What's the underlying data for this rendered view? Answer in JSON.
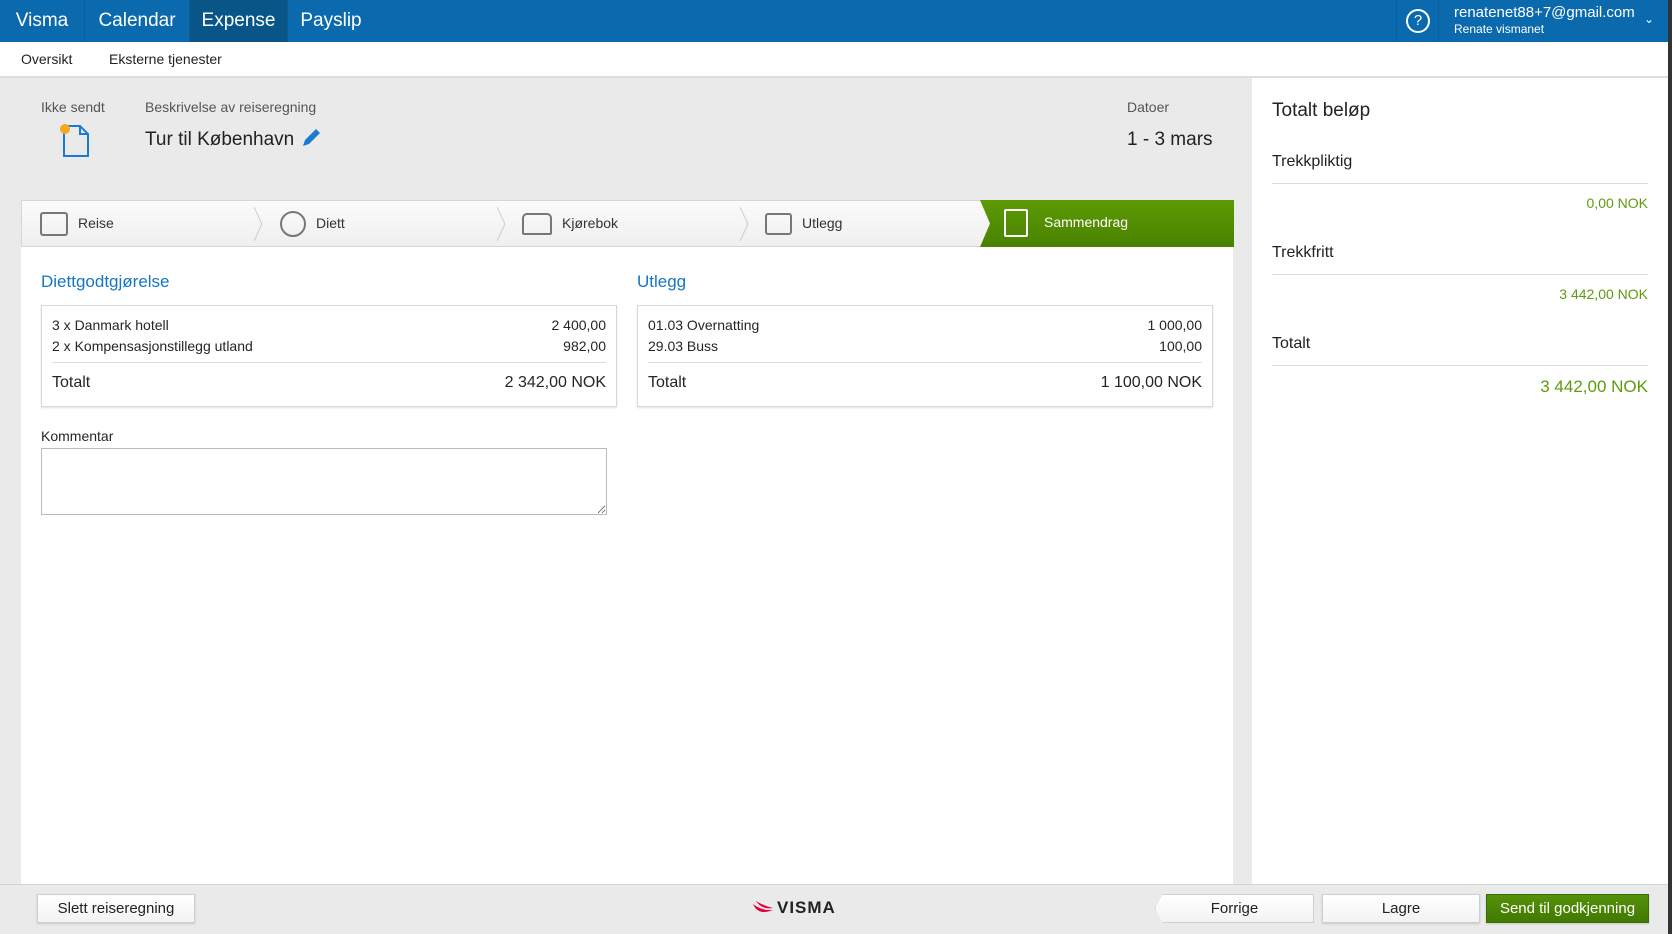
{
  "topnav": {
    "items": [
      "Visma",
      "Calendar",
      "Expense",
      "Payslip"
    ],
    "active": "Expense",
    "user_email": "renatenet88+7@gmail.com",
    "user_name": "Renate vismanet"
  },
  "subnav": {
    "items": [
      "Oversikt",
      "Eksterne tjenester"
    ]
  },
  "header": {
    "status": "Ikke sendt",
    "desc_label": "Beskrivelse av reiseregning",
    "title": "Tur til København",
    "dates_label": "Datoer",
    "dates": "1 - 3 mars"
  },
  "steps": [
    "Reise",
    "Diett",
    "Kjørebok",
    "Utlegg",
    "Sammendrag"
  ],
  "diett": {
    "heading": "Diettgodtgjørelse",
    "rows": [
      {
        "label": "3 x Danmark hotell",
        "amount": "2 400,00"
      },
      {
        "label": "2 x Kompensasjonstillegg utland",
        "amount": "982,00"
      }
    ],
    "total_label": "Totalt",
    "total": "2 342,00 NOK"
  },
  "utlegg": {
    "heading": "Utlegg",
    "rows": [
      {
        "label": "01.03 Overnatting",
        "amount": "1 000,00"
      },
      {
        "label": "29.03 Buss",
        "amount": "100,00"
      }
    ],
    "total_label": "Totalt",
    "total": "1 100,00 NOK"
  },
  "comment": {
    "label": "Kommentar",
    "value": ""
  },
  "summary": {
    "title": "Totalt beløp",
    "trekkpliktig_label": "Trekkpliktig",
    "trekkpliktig": "0,00 NOK",
    "trekkfritt_label": "Trekkfritt",
    "trekkfritt": "3 442,00 NOK",
    "total_label": "Totalt",
    "total": "3 442,00 NOK"
  },
  "footer": {
    "delete": "Slett reiseregning",
    "logo": "VISMA",
    "prev": "Forrige",
    "save": "Lagre",
    "send": "Send til godkjenning"
  },
  "colors": {
    "brand": "#0b6aad",
    "green": "#4f8a02",
    "link": "#1676c0"
  }
}
